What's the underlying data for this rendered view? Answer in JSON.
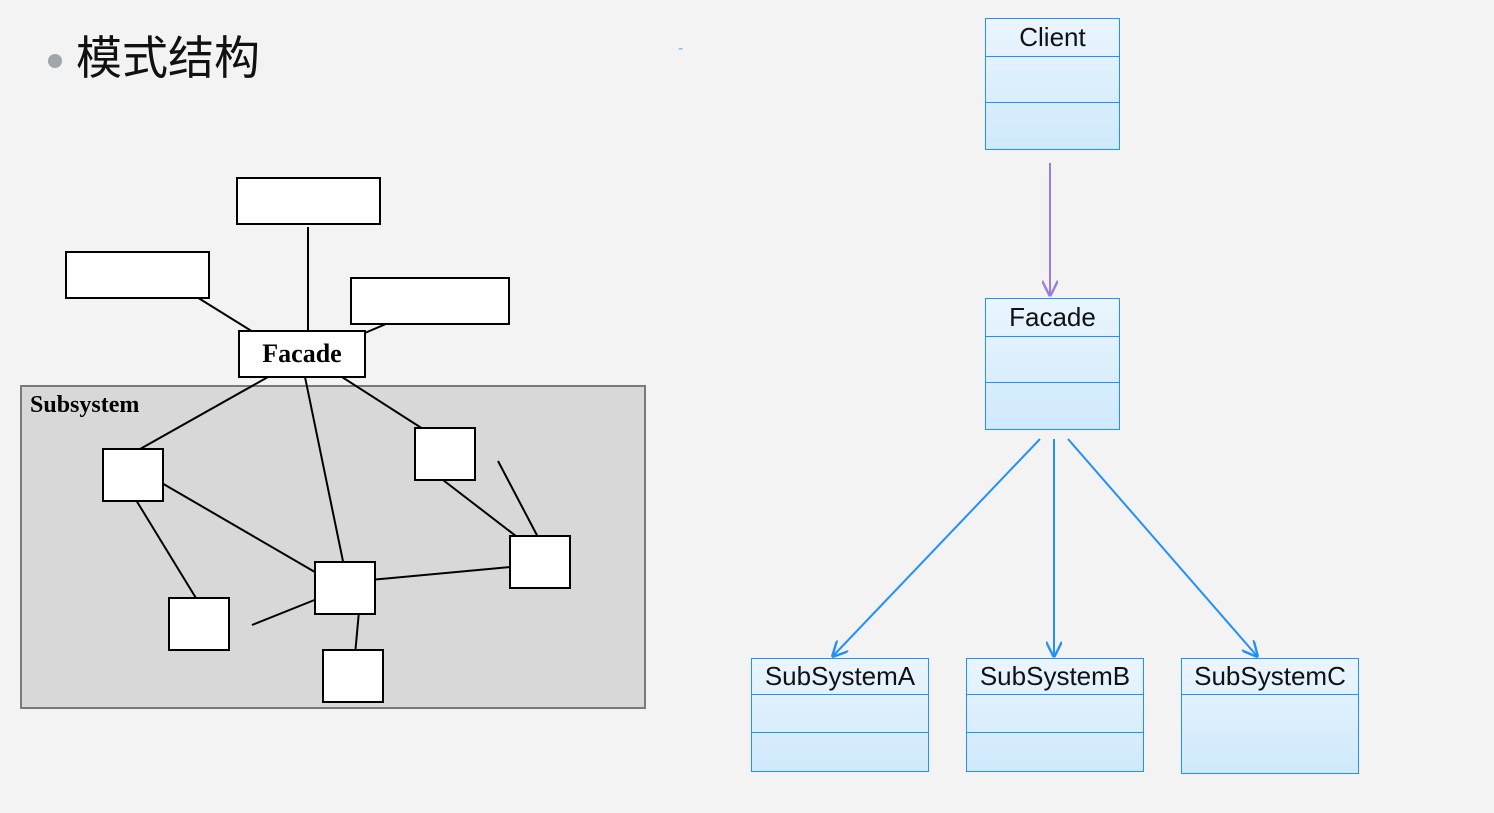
{
  "title": "模式结构",
  "left": {
    "facade": "Facade",
    "subsystem_label": "Subsystem"
  },
  "right": {
    "client": "Client",
    "facade": "Facade",
    "sub_a": "SubSystemA",
    "sub_b": "SubSystemB",
    "sub_c": "SubSystemC"
  }
}
